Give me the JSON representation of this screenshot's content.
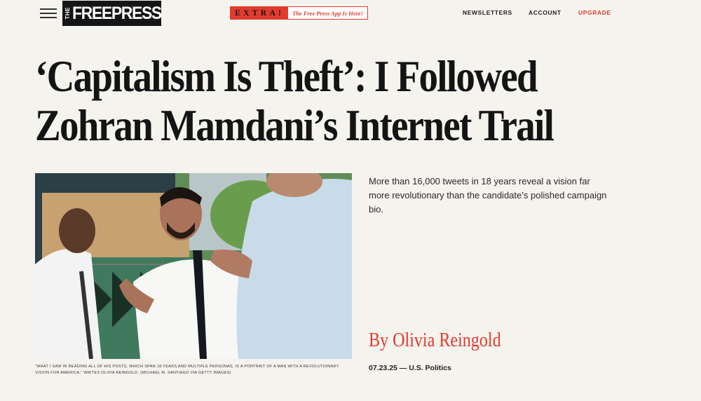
{
  "header": {
    "logo_the": "THE",
    "logo_name": "FREEPRESS",
    "extra_tag": "EXTRA!",
    "extra_message": "The Free Press App Is Here!",
    "nav": [
      "NEWSLETTERS",
      "ACCOUNT",
      "UPGRADE"
    ],
    "accent_color": "#e23b2e"
  },
  "article": {
    "headline": "‘Capitalism Is Theft’: I Followed Zohran Mamdani’s Internet Trail",
    "dek": "More than 16,000 tweets in 18 years reveal a vision far more revolutionary than the candidate’s polished campaign bio.",
    "byline": "By Olivia Reingold",
    "date": "07.23.25",
    "separator": " — ",
    "section": "U.S. Politics",
    "caption": "“What I saw in reading all of his posts, which span 18 years and multiple personas, is a portrait of a man with a revolutionary vision for America,” writes Olivia Reingold. (Michael M. Santiago via Getty Images)"
  }
}
